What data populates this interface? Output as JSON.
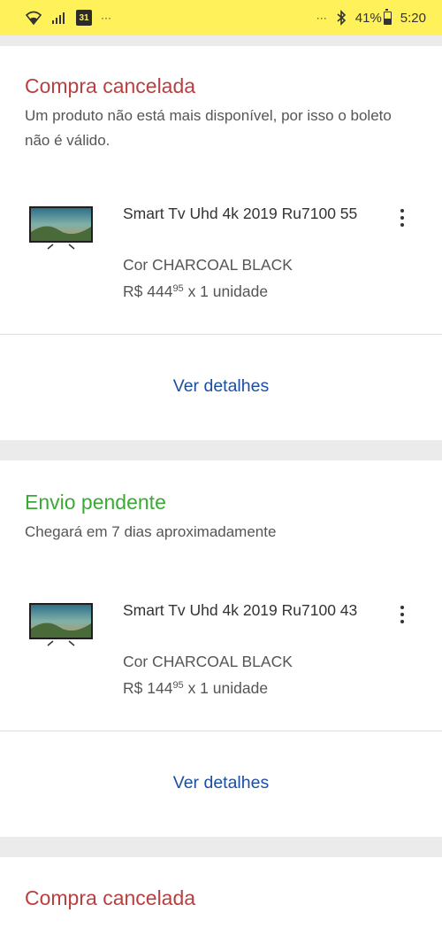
{
  "status_bar": {
    "left_dots": "···",
    "calendar_day": "31",
    "right_dots": "···",
    "battery": "41%",
    "time": "5:20"
  },
  "colors": {
    "status_bar_bg": "#fff159",
    "cancel_title": "#b84040",
    "pending_title": "#3aaa35",
    "link": "#1c4ea1"
  },
  "orders": [
    {
      "status": "Compra cancelada",
      "description": "Um produto não está mais disponível, por isso o boleto não é válido.",
      "product": {
        "title": "Smart Tv Uhd 4k 2019 Ru7100 55",
        "color": "Cor CHARCOAL BLACK",
        "price_currency": "R$ 444",
        "price_cents": "95",
        "quantity": "x 1 unidade"
      },
      "details_label": "Ver detalhes"
    },
    {
      "status": "Envio pendente",
      "description": "Chegará em 7 dias aproximadamente",
      "product": {
        "title": "Smart Tv Uhd 4k 2019 Ru7100 43",
        "color": "Cor CHARCOAL BLACK",
        "price_currency": "R$ 144",
        "price_cents": "95",
        "quantity": "x 1 unidade"
      },
      "details_label": "Ver detalhes"
    },
    {
      "status": "Compra cancelada"
    }
  ]
}
